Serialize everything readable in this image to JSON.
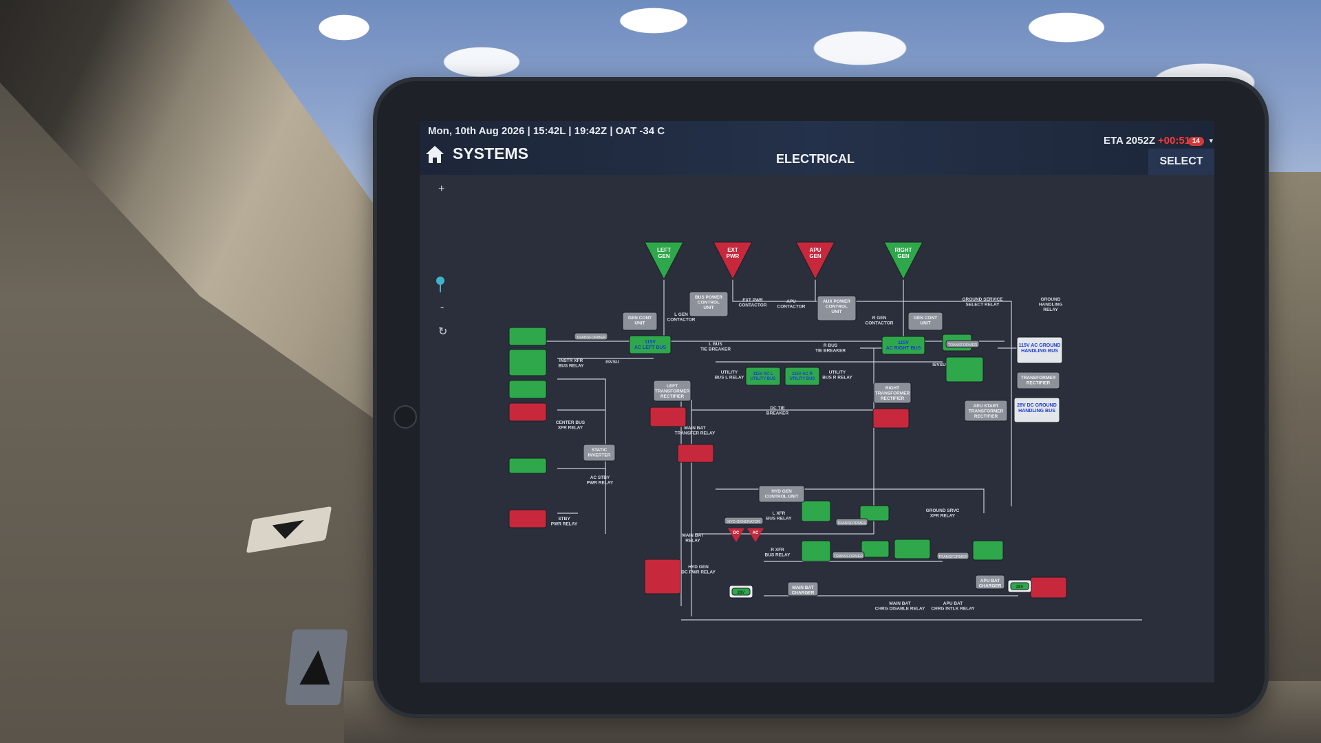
{
  "status_bar": {
    "datetime": "Mon, 10th Aug 2026 | 15:42L | 19:42Z | OAT -34 C",
    "eta": "ETA 2052Z",
    "delay": "+00:51",
    "badge": "14"
  },
  "header": {
    "app_title": "SYSTEMS",
    "page_title": "ELECTRICAL",
    "select_label": "SELECT"
  },
  "tools": {
    "zoom_in": "+",
    "zoom_out": "-",
    "reset": "↻"
  },
  "diagram": {
    "sources": {
      "left_gen": [
        "LEFT",
        "GEN"
      ],
      "ext_pwr": [
        "EXT",
        "PWR"
      ],
      "apu_gen": [
        "APU",
        "GEN"
      ],
      "right_gen": [
        "RIGHT",
        "GEN"
      ]
    },
    "gray_boxes": {
      "gen_cont_unit_left": [
        "GEN CONT",
        "UNIT"
      ],
      "bus_power_control_unit": [
        "BUS POWER",
        "CONTROL",
        "UNIT"
      ],
      "aux_power_control_unit": [
        "AUX POWER",
        "CONTROL",
        "UNIT"
      ],
      "gen_cont_unit_right": [
        "GEN CONT",
        "UNIT"
      ],
      "left_transformer_rectifier": [
        "LEFT",
        "TRANSFORMER",
        "RECTIFIER"
      ],
      "right_transformer_rectifier": [
        "RIGHT",
        "TRANSFORMER",
        "RECTIFIER"
      ],
      "apu_start_transformer_rectifier": [
        "APU START",
        "TRANSFORMER",
        "RECTIFIER"
      ],
      "static_inverter": [
        "STATIC",
        "INVERTER"
      ],
      "hyd_gen_control_unit": [
        "HYD GEN",
        "CONTROL UNIT"
      ],
      "transformer_rectifier_gnd": [
        "TRANSFORMER",
        "RECTIFIER"
      ],
      "transformer_l": "TRANSFORMER",
      "transformer_r": "TRANSFORMER",
      "transformer_mid1": "TRANSFORMER",
      "transformer_mid2": "TRANSFORMER",
      "transformer_mid3": "TRANSFORMER",
      "hyd_generator": "HYD GENERATOR"
    },
    "white_boxes": {
      "ac_ground_handling_bus": [
        "115V AC GROUND",
        "HANDLING BUS"
      ],
      "dc_ground_handling_bus": [
        "28V DC GROUND",
        "HANDLING BUS"
      ]
    },
    "bus_labels": {
      "left_ac_bus": [
        "115V",
        "AC LEFT BUS"
      ],
      "right_ac_bus": [
        "115V",
        "AC RIGHT BUS"
      ],
      "utility_l": [
        "115V AC L",
        "UTILITY BUS"
      ],
      "utility_r": [
        "115V AC R",
        "UTILITY BUS"
      ]
    },
    "chargers": {
      "main_bat_charger": [
        "MAIN BAT",
        "CHARGER"
      ],
      "apu_bat_charger": [
        "APU BAT",
        "CHARGER"
      ]
    },
    "hyd_gen_labels": {
      "dc": "DC",
      "ac": "AC"
    },
    "battery_labels": {
      "main": "28V",
      "apu": "28V"
    },
    "annotations": {
      "l_gen_contactor": [
        "L GEN",
        "CONTACTOR"
      ],
      "ext_pwr_contactor": [
        "EXT PWR",
        "CONTACTOR"
      ],
      "apu_contactor": [
        "APU",
        "CONTACTOR"
      ],
      "r_gen_contactor": [
        "R GEN",
        "CONTACTOR"
      ],
      "ground_service_select_relay": [
        "GROUND SERVICE",
        "SELECT RELAY"
      ],
      "ground_handling_relay": [
        "GROUND",
        "HANDLING",
        "RELAY"
      ],
      "l_bus_tie_breaker": [
        "L BUS",
        "TIE BREAKER"
      ],
      "r_bus_tie_breaker": [
        "R BUS",
        "TIE BREAKER"
      ],
      "instr_xfr_bus_relay": [
        "INSTR XFR",
        "BUS RELAY"
      ],
      "isvsu_left": "ISVSU",
      "isvsu_right": "ISVSU",
      "utility_bus_l_relay": [
        "UTILITY",
        "BUS L RELAY"
      ],
      "utility_bus_r_relay": [
        "UTILITY",
        "BUS R RELAY"
      ],
      "dc_tie_breaker": [
        "DC TIE",
        "BREAKER"
      ],
      "center_bus_xfr_relay": [
        "CENTER BUS",
        "XFR RELAY"
      ],
      "main_bat_transfer_relay": [
        "MAIN BAT",
        "TRANSFER RELAY"
      ],
      "ac_stby_pwr_relay": [
        "AC STBY",
        "PWR RELAY"
      ],
      "stby_pwr_relay": [
        "STBY",
        "PWR RELAY"
      ],
      "ground_srvc_xfr_relay": [
        "GROUND SRVC",
        "XFR RELAY"
      ],
      "l_xfr_bus_relay": [
        "L XFR",
        "BUS RELAY"
      ],
      "r_xfr_bus_relay": [
        "R XFR",
        "BUS RELAY"
      ],
      "main_bat_relay": [
        "MAIN BAT",
        "RELAY"
      ],
      "hyd_gen_dc_pwr_relay": [
        "HYD GEN",
        "DC PWR RELAY"
      ],
      "main_bat_chrg_disable_relay": [
        "MAIN BAT",
        "CHRG DISABLE RELAY"
      ],
      "apu_bat_chrg_intlk_relay": [
        "APU BAT",
        "CHRG INTLK RELAY"
      ]
    }
  },
  "colors": {
    "green_bus": "#2ea84a",
    "red_bus": "#c8283c",
    "gray_unit": "#8d9199",
    "white_bus": "#e3e6ea",
    "line": "#c9ced6",
    "label": "#d9dde4",
    "screen_bg": "#2a2f3b",
    "bus_text": "#1d3bd4"
  }
}
